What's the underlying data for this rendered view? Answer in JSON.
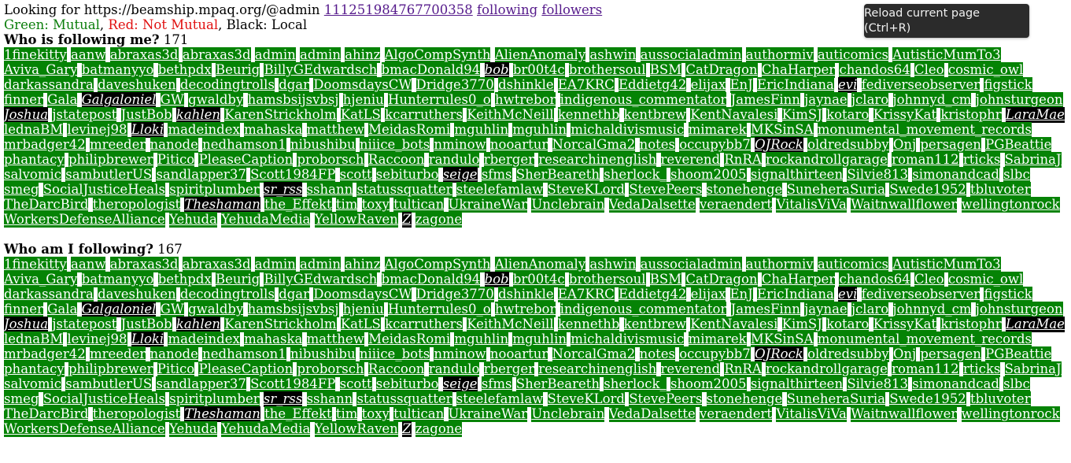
{
  "header": {
    "prefix": "Looking for https://beamship.mpaq.org/@admin",
    "id_link": "111251984767700358",
    "following_link": "following",
    "followers_link": "followers"
  },
  "legend": {
    "green": "Green: Mutual",
    "sep1": ", ",
    "red": "Red: Not Mutual",
    "sep2": ", Black: Local"
  },
  "tooltip": "Reload current page (Ctrl+R)",
  "colors": {
    "mutual": "#058305",
    "not_mutual": "#d00000",
    "local": "#000000"
  },
  "followers": {
    "title": "Who is following me?",
    "count": "171",
    "accounts": [
      {
        "n": "1finekitty",
        "t": "green"
      },
      {
        "n": "aanw",
        "t": "green"
      },
      {
        "n": "abraxas3d",
        "t": "green"
      },
      {
        "n": "abraxas3d",
        "t": "green"
      },
      {
        "n": "admin",
        "t": "green"
      },
      {
        "n": "admin",
        "t": "green"
      },
      {
        "n": "ahinz",
        "t": "green"
      },
      {
        "n": "AlgoCompSynth",
        "t": "green"
      },
      {
        "n": "AlienAnomaly",
        "t": "green"
      },
      {
        "n": "ashwin",
        "t": "green"
      },
      {
        "n": "aussocialadmin",
        "t": "green"
      },
      {
        "n": "authormiv",
        "t": "green"
      },
      {
        "n": "auticomics",
        "t": "green"
      },
      {
        "n": "AutisticMumTo3",
        "t": "green"
      },
      {
        "n": "Aviva_Gary",
        "t": "green"
      },
      {
        "n": "batmanyyo",
        "t": "green"
      },
      {
        "n": "bethpdx",
        "t": "green"
      },
      {
        "n": "Beurig",
        "t": "green"
      },
      {
        "n": "BillyGEdwardsch",
        "t": "green"
      },
      {
        "n": "bmacDonald94",
        "t": "green"
      },
      {
        "n": "bob",
        "t": "black"
      },
      {
        "n": "br00t4c",
        "t": "green"
      },
      {
        "n": "brothersoul",
        "t": "green"
      },
      {
        "n": "BSM",
        "t": "green"
      },
      {
        "n": "CatDragon",
        "t": "green"
      },
      {
        "n": "ChaHarper",
        "t": "green"
      },
      {
        "n": "chandos64",
        "t": "green"
      },
      {
        "n": "Cleo",
        "t": "green"
      },
      {
        "n": "cosmic_owl",
        "t": "green"
      },
      {
        "n": "darkassandra",
        "t": "green"
      },
      {
        "n": "daveshuken",
        "t": "green"
      },
      {
        "n": "decodingtrolls",
        "t": "green"
      },
      {
        "n": "dgar",
        "t": "green"
      },
      {
        "n": "DoomsdaysCW",
        "t": "green"
      },
      {
        "n": "Dridge3770",
        "t": "green"
      },
      {
        "n": "dshinkle",
        "t": "green"
      },
      {
        "n": "EA7KRC",
        "t": "green"
      },
      {
        "n": "Eddietg42",
        "t": "green"
      },
      {
        "n": "elijax",
        "t": "green"
      },
      {
        "n": "EnJ",
        "t": "green"
      },
      {
        "n": "EricIndiana",
        "t": "green"
      },
      {
        "n": "evi",
        "t": "black"
      },
      {
        "n": "fediverseobserver",
        "t": "green"
      },
      {
        "n": "figstick",
        "t": "green"
      },
      {
        "n": "finner",
        "t": "green"
      },
      {
        "n": "Gala",
        "t": "green"
      },
      {
        "n": "Galgaloniel",
        "t": "black"
      },
      {
        "n": "GW",
        "t": "green"
      },
      {
        "n": "gwaldby",
        "t": "green"
      },
      {
        "n": "hamsbsijsvbsj",
        "t": "green"
      },
      {
        "n": "hjeniu",
        "t": "green"
      },
      {
        "n": "Hunterrules0_o",
        "t": "green"
      },
      {
        "n": "hwtrebor",
        "t": "green"
      },
      {
        "n": "indigenous_commentator",
        "t": "green"
      },
      {
        "n": "JamesFinn",
        "t": "green"
      },
      {
        "n": "jaynae",
        "t": "green"
      },
      {
        "n": "jclaro",
        "t": "green"
      },
      {
        "n": "johnnyd_cm",
        "t": "green"
      },
      {
        "n": "johnsturgeon",
        "t": "green"
      },
      {
        "n": "Joshua",
        "t": "black"
      },
      {
        "n": "jstatepost",
        "t": "green"
      },
      {
        "n": "JustBob",
        "t": "green"
      },
      {
        "n": "kahlen",
        "t": "black"
      },
      {
        "n": "KarenStrickholm",
        "t": "green"
      },
      {
        "n": "KatLS",
        "t": "green"
      },
      {
        "n": "kcarruthers",
        "t": "green"
      },
      {
        "n": "KeithMcNeill",
        "t": "green"
      },
      {
        "n": "kennethb",
        "t": "green"
      },
      {
        "n": "kentbrew",
        "t": "green"
      },
      {
        "n": "KentNavalesi",
        "t": "green"
      },
      {
        "n": "KimSJ",
        "t": "green"
      },
      {
        "n": "kotaro",
        "t": "green"
      },
      {
        "n": "KrissyKat",
        "t": "green"
      },
      {
        "n": "kristophr",
        "t": "green"
      },
      {
        "n": "LaraMae",
        "t": "black"
      },
      {
        "n": "lednaBM",
        "t": "green"
      },
      {
        "n": "levinej98",
        "t": "green"
      },
      {
        "n": "Lloki",
        "t": "black"
      },
      {
        "n": "madeindex",
        "t": "green"
      },
      {
        "n": "mahaska",
        "t": "green"
      },
      {
        "n": "matthew",
        "t": "green"
      },
      {
        "n": "MeidasRomi",
        "t": "green"
      },
      {
        "n": "mguhlin",
        "t": "green"
      },
      {
        "n": "mguhlin",
        "t": "green"
      },
      {
        "n": "michaldivismusic",
        "t": "green"
      },
      {
        "n": "mimarek",
        "t": "green"
      },
      {
        "n": "MKSinSA",
        "t": "green"
      },
      {
        "n": "monumental_movement_records",
        "t": "green"
      },
      {
        "n": "mrbadger42",
        "t": "green"
      },
      {
        "n": "mreeder",
        "t": "green"
      },
      {
        "n": "nanode",
        "t": "green"
      },
      {
        "n": "nedhamson1",
        "t": "green"
      },
      {
        "n": "nibushibu",
        "t": "green"
      },
      {
        "n": "niiice_bots",
        "t": "green"
      },
      {
        "n": "nminow",
        "t": "green"
      },
      {
        "n": "nooartur",
        "t": "green"
      },
      {
        "n": "NorcalGma2",
        "t": "green"
      },
      {
        "n": "notes",
        "t": "green"
      },
      {
        "n": "occupybb7",
        "t": "green"
      },
      {
        "n": "OJRock",
        "t": "black"
      },
      {
        "n": "oldredsubby",
        "t": "green"
      },
      {
        "n": "Onj",
        "t": "green"
      },
      {
        "n": "persagen",
        "t": "green"
      },
      {
        "n": "PGBeattie",
        "t": "green"
      },
      {
        "n": "phantacy",
        "t": "green"
      },
      {
        "n": "philipbrewer",
        "t": "green"
      },
      {
        "n": "Pitico",
        "t": "green"
      },
      {
        "n": "PleaseCaption",
        "t": "green"
      },
      {
        "n": "proborsch",
        "t": "green"
      },
      {
        "n": "Raccoon",
        "t": "green"
      },
      {
        "n": "randulo",
        "t": "green"
      },
      {
        "n": "rberger",
        "t": "green"
      },
      {
        "n": "researchinenglish",
        "t": "green"
      },
      {
        "n": "reverend",
        "t": "green"
      },
      {
        "n": "RnRA",
        "t": "green"
      },
      {
        "n": "rockandrollgarage",
        "t": "green"
      },
      {
        "n": "roman112",
        "t": "green"
      },
      {
        "n": "rticks",
        "t": "green"
      },
      {
        "n": "SabrinaJ",
        "t": "green"
      },
      {
        "n": "salvomic",
        "t": "green"
      },
      {
        "n": "sambutlerUS",
        "t": "green"
      },
      {
        "n": "sandlapper37",
        "t": "green"
      },
      {
        "n": "Scott1984FP",
        "t": "green"
      },
      {
        "n": "scott",
        "t": "green"
      },
      {
        "n": "sebiturbo",
        "t": "green"
      },
      {
        "n": "seige",
        "t": "black"
      },
      {
        "n": "sfms",
        "t": "green"
      },
      {
        "n": "SherBeareth",
        "t": "green"
      },
      {
        "n": "sherlock_",
        "t": "green"
      },
      {
        "n": "shoom2005",
        "t": "green"
      },
      {
        "n": "signalthirteen",
        "t": "green"
      },
      {
        "n": "Silvie813",
        "t": "green"
      },
      {
        "n": "simonandcad",
        "t": "green"
      },
      {
        "n": "slbc",
        "t": "green"
      },
      {
        "n": "smeg",
        "t": "green"
      },
      {
        "n": "SocialJusticeHeals",
        "t": "green"
      },
      {
        "n": "spiritplumber",
        "t": "green"
      },
      {
        "n": "sr_rss",
        "t": "black"
      },
      {
        "n": "sshann",
        "t": "green"
      },
      {
        "n": "statussquatter",
        "t": "green"
      },
      {
        "n": "steelefamlaw",
        "t": "green"
      },
      {
        "n": "SteveKLord",
        "t": "green"
      },
      {
        "n": "StevePeers",
        "t": "green"
      },
      {
        "n": "stonehenge",
        "t": "green"
      },
      {
        "n": "SuneheraSuria",
        "t": "green"
      },
      {
        "n": "Swede1952",
        "t": "green"
      },
      {
        "n": "tbluvoter",
        "t": "green"
      },
      {
        "n": "TheDarcBird",
        "t": "green"
      },
      {
        "n": "theropologist",
        "t": "green"
      },
      {
        "n": "Theshaman",
        "t": "black"
      },
      {
        "n": "the_Effekt",
        "t": "green"
      },
      {
        "n": "tim",
        "t": "green"
      },
      {
        "n": "toxy",
        "t": "green"
      },
      {
        "n": "tultican",
        "t": "green"
      },
      {
        "n": "UkraineWar",
        "t": "green"
      },
      {
        "n": "Unclebrain",
        "t": "green"
      },
      {
        "n": "VedaDalsette",
        "t": "green"
      },
      {
        "n": "veraendert",
        "t": "green"
      },
      {
        "n": "VitalisViVa",
        "t": "green"
      },
      {
        "n": "Waitnwallflower",
        "t": "green"
      },
      {
        "n": "wellingtonrock",
        "t": "green"
      },
      {
        "n": "WorkersDefenseAlliance",
        "t": "green"
      },
      {
        "n": "Yehuda",
        "t": "green"
      },
      {
        "n": "YehudaMedia",
        "t": "green"
      },
      {
        "n": "YellowRaven",
        "t": "green"
      },
      {
        "n": "Z",
        "t": "black"
      },
      {
        "n": "zagone",
        "t": "green"
      }
    ]
  },
  "following": {
    "title": "Who am I following?",
    "count": "167",
    "same_as_followers": true
  }
}
